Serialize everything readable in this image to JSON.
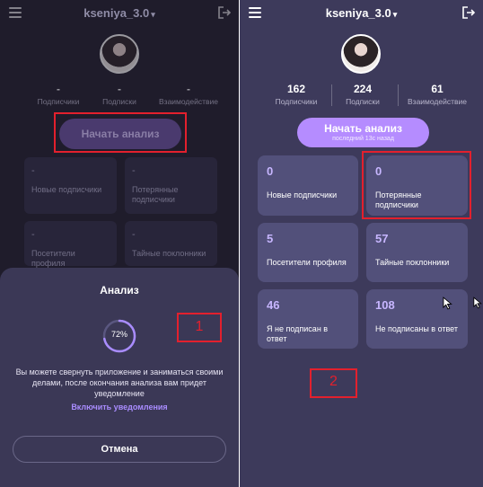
{
  "left": {
    "header": {
      "username": "kseniya_3.0"
    },
    "stats": [
      {
        "value": "-",
        "label": "Подписчики"
      },
      {
        "value": "-",
        "label": "Подписки"
      },
      {
        "value": "-",
        "label": "Взаимодействие"
      }
    ],
    "start_button": {
      "label": "Начать анализ"
    },
    "cards": [
      {
        "value": "-",
        "label": "Новые подписчики"
      },
      {
        "value": "-",
        "label": "Потерянные подписчики"
      },
      {
        "value": "-",
        "label": "Посетители профиля"
      },
      {
        "value": "-",
        "label": "Тайные поклонники"
      }
    ],
    "sheet": {
      "title": "Анализ",
      "progress_text": "72%",
      "progress": 0.72,
      "message": "Вы можете свернуть приложение и заниматься своими делами, после окончания анализа вам придет уведомление",
      "notify_link": "Включить уведомления",
      "cancel_label": "Отмена"
    },
    "annotation_label": "1"
  },
  "right": {
    "header": {
      "username": "kseniya_3.0"
    },
    "stats": [
      {
        "value": "162",
        "label": "Подписчики"
      },
      {
        "value": "224",
        "label": "Подписки"
      },
      {
        "value": "61",
        "label": "Взаимодействие"
      }
    ],
    "start_button": {
      "label": "Начать анализ",
      "sublabel": "последний 13с назад"
    },
    "cards": [
      {
        "value": "0",
        "label": "Новые подписчики"
      },
      {
        "value": "0",
        "label": "Потерянные подписчики"
      },
      {
        "value": "5",
        "label": "Посетители профиля"
      },
      {
        "value": "57",
        "label": "Тайные поклонники"
      },
      {
        "value": "46",
        "label": "Я не подписан в ответ"
      },
      {
        "value": "108",
        "label": "Не подписаны в ответ"
      }
    ],
    "annotation_label": "2"
  },
  "colors": {
    "left_bg": "#1f1c2b",
    "right_bg": "#3d3a5b",
    "accent": "#b58cff",
    "annotation": "#e3202d",
    "card_bg": "#52507a"
  },
  "icons": [
    "menu-icon",
    "chevron-down-icon",
    "logout-icon",
    "avatar",
    "cursor-icon"
  ]
}
